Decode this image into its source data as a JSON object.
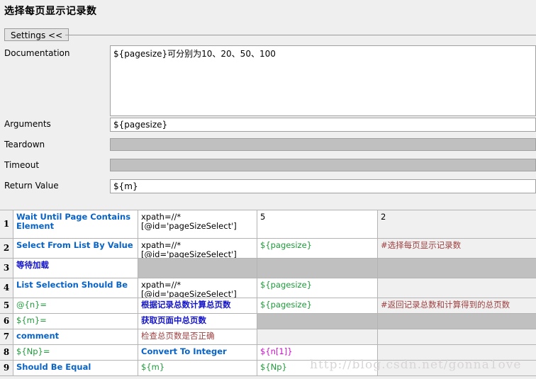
{
  "page_title": "选择每页显示记录数",
  "tab": {
    "label": "Settings <<"
  },
  "form": {
    "documentation": {
      "label": "Documentation",
      "value": "${pagesize}可分别为10、20、50、100"
    },
    "arguments": {
      "label": "Arguments",
      "value": "${pagesize}"
    },
    "teardown": {
      "label": "Teardown",
      "value": ""
    },
    "timeout": {
      "label": "Timeout",
      "value": ""
    },
    "return_value": {
      "label": "Return Value",
      "value": "${m}"
    }
  },
  "grid": {
    "rows": [
      {
        "num": "1",
        "c1": "Wait Until Page Contains Element",
        "c2": "xpath=//*[@id='pageSizeSelect']",
        "c3": "5",
        "c4": "2"
      },
      {
        "num": "2",
        "c1": "Select From List By Value",
        "c2": "xpath=//*[@id='pageSizeSelect']",
        "c3": "${pagesize}",
        "c4": "#选择每页显示记录数"
      },
      {
        "num": "3",
        "c1": "等待加载",
        "c2": "",
        "c3": "",
        "c4": ""
      },
      {
        "num": "4",
        "c1": "List Selection Should Be",
        "c2": "xpath=//*[@id='pageSizeSelect']",
        "c3": "${pagesize}",
        "c4": ""
      },
      {
        "num": "5",
        "c1": "@{n}=",
        "c2": "根据记录总数计算总页数",
        "c3": "${pagesize}",
        "c4": "#返回记录总数和计算得到的总页数"
      },
      {
        "num": "6",
        "c1": "${m}=",
        "c2": "获取页面中总页数",
        "c3": "",
        "c4": ""
      },
      {
        "num": "7",
        "c1": "comment",
        "c2": "检查总页数是否正确",
        "c3": "",
        "c4": ""
      },
      {
        "num": "8",
        "c1": "${Np}=",
        "c2": "Convert To Integer",
        "c3": "${n[1]}",
        "c4": ""
      },
      {
        "num": "9",
        "c1": "Should Be Equal",
        "c2": "${m}",
        "c3": "${Np}",
        "c4": ""
      }
    ]
  },
  "watermark": "http://blog.csdn.net/gonna1ove",
  "colors": {
    "keyword_blue": "#0a63c6",
    "chinese_keyword_blue": "#1414c8",
    "variable_green": "#1f9c3a",
    "variable_pink": "#d10fd1",
    "comment_brown": "#9e4040",
    "disabled_gray": "#c0c0c0",
    "panel_gray": "#efefef"
  }
}
